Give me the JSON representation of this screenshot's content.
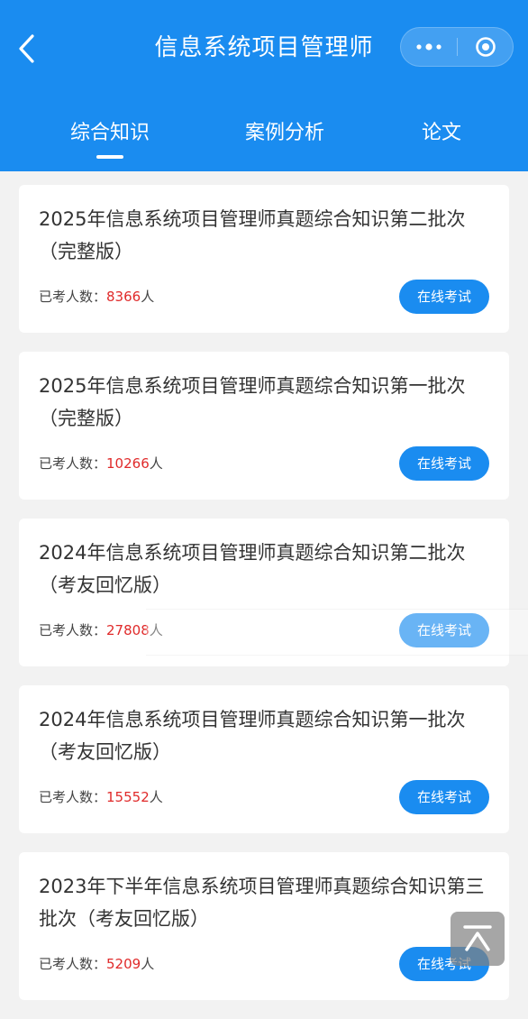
{
  "nav": {
    "title": "信息系统项目管理师",
    "back_icon": "chevron-left-icon",
    "more_icon": "more-dots-icon",
    "record_icon": "record-circle-icon"
  },
  "tabs": [
    {
      "label": "综合知识",
      "active": true
    },
    {
      "label": "案例分析",
      "active": false
    },
    {
      "label": "论文",
      "active": false
    }
  ],
  "items": [
    {
      "title": "2025年信息系统项目管理师真题综合知识第二批次（完整版）",
      "meta_label": "已考人数：",
      "count": "8366",
      "unit": "人",
      "button": "在线考试"
    },
    {
      "title": "2025年信息系统项目管理师真题综合知识第一批次（完整版）",
      "meta_label": "已考人数：",
      "count": "10266",
      "unit": "人",
      "button": "在线考试"
    },
    {
      "title": "2024年信息系统项目管理师真题综合知识第二批次（考友回忆版）",
      "meta_label": "已考人数：",
      "count": "27808",
      "unit": "人",
      "button": "在线考试"
    },
    {
      "title": "2024年信息系统项目管理师真题综合知识第一批次（考友回忆版）",
      "meta_label": "已考人数：",
      "count": "15552",
      "unit": "人",
      "button": "在线考试"
    },
    {
      "title": "2023年下半年信息系统项目管理师真题综合知识第三批次（考友回忆版）",
      "meta_label": "已考人数：",
      "count": "5209",
      "unit": "人",
      "button": "在线考试"
    }
  ],
  "colors": {
    "primary": "#1a8cf0",
    "count_red": "#e02a2a",
    "background": "#f2f2f2"
  },
  "back_to_top_icon": "back-to-top-icon"
}
